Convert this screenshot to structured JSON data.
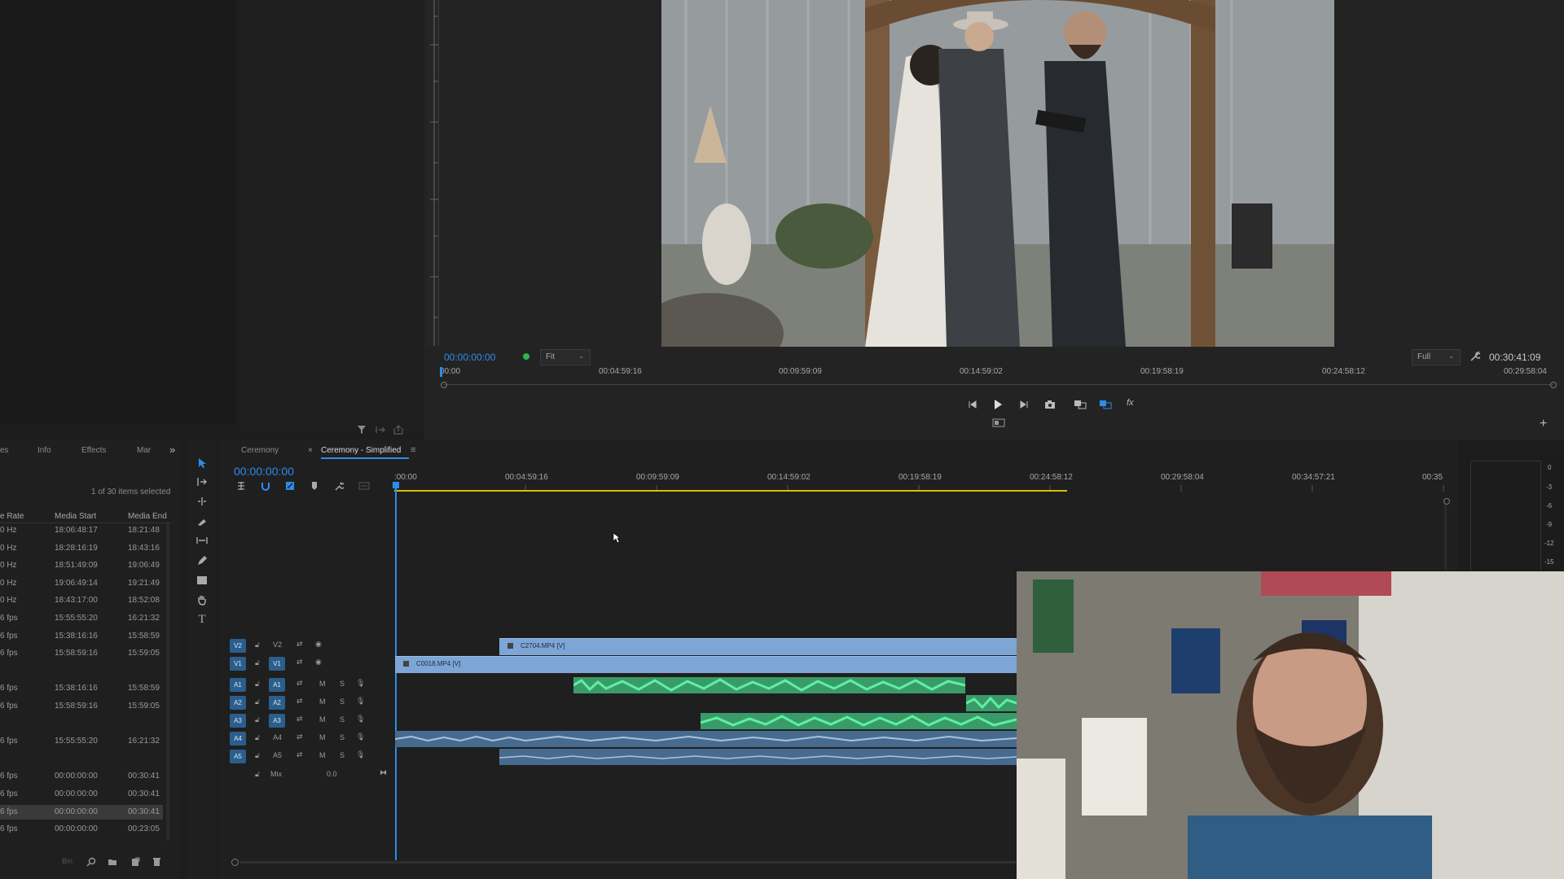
{
  "program_monitor": {
    "timecode_current": "00:00:00:00",
    "fit_label": "Fit",
    "quality_label": "Full",
    "timecode_duration": "00:30:41:09",
    "ruler_ticks": [
      "00:00",
      "00:04:59:16",
      "00:09:59:09",
      "00:14:59:02",
      "00:19:58:19",
      "00:24:58:12",
      "00:29:58:04"
    ]
  },
  "project_panel": {
    "tabs": [
      "es",
      "Info",
      "Effects",
      "Mar"
    ],
    "items_selected": "1 of 30 items selected",
    "columns": [
      "e Rate",
      "Media Start",
      "Media End"
    ],
    "rows": [
      {
        "rate": "0 Hz",
        "start": "18:06:48:17",
        "end": "18:21:48"
      },
      {
        "rate": "0 Hz",
        "start": "18:28:16:19",
        "end": "18:43:16"
      },
      {
        "rate": "0 Hz",
        "start": "18:51:49:09",
        "end": "19:06:49"
      },
      {
        "rate": "0 Hz",
        "start": "19:06:49:14",
        "end": "19:21:49"
      },
      {
        "rate": "0 Hz",
        "start": "18:43:17:00",
        "end": "18:52:08"
      },
      {
        "rate": "6 fps",
        "start": "15:55:55:20",
        "end": "16:21:32"
      },
      {
        "rate": "6 fps",
        "start": "15:38:16:16",
        "end": "15:58:59"
      },
      {
        "rate": "6 fps",
        "start": "15:58:59:16",
        "end": "15:59:05"
      },
      {
        "rate": "",
        "start": "",
        "end": ""
      },
      {
        "rate": "6 fps",
        "start": "15:38:16:16",
        "end": "15:58:59"
      },
      {
        "rate": "6 fps",
        "start": "15:58:59:16",
        "end": "15:59:05"
      },
      {
        "rate": "",
        "start": "",
        "end": ""
      },
      {
        "rate": "6 fps",
        "start": "15:55:55:20",
        "end": "16:21:32"
      },
      {
        "rate": "",
        "start": "",
        "end": ""
      },
      {
        "rate": "6 fps",
        "start": "00:00:00:00",
        "end": "00:30:41"
      },
      {
        "rate": "6 fps",
        "start": "00:00:00:00",
        "end": "00:30:41"
      },
      {
        "rate": "6 fps",
        "start": "00:00:00:00",
        "end": "00:30:41"
      },
      {
        "rate": "6 fps",
        "start": "00:00:00:00",
        "end": "00:23:05"
      }
    ]
  },
  "timeline": {
    "tabs": [
      "Ceremony",
      "Ceremony - Simplified"
    ],
    "timecode": "00:00:00:00",
    "ruler_ticks": [
      ":00:00",
      "00:04:59:16",
      "00:09:59:09",
      "00:14:59:02",
      "00:19:58:19",
      "00:24:58:12",
      "00:29:58:04",
      "00:34:57:21",
      "00:35"
    ],
    "tracks": {
      "v2": "V2",
      "v1": "V1",
      "a1": "A1",
      "a2": "A2",
      "a3": "A3",
      "a4": "A4",
      "a5": "A5",
      "mix_label": "Mix",
      "mix_value": "0.0"
    },
    "clips": {
      "v2": "C2704.MP4 [V]",
      "v1": "C0018.MP4 [V]"
    },
    "mute_label": "M",
    "solo_label": "S"
  },
  "meter": {
    "scale": [
      "0",
      "-3",
      "-6",
      "-9",
      "-12",
      "-15"
    ]
  }
}
